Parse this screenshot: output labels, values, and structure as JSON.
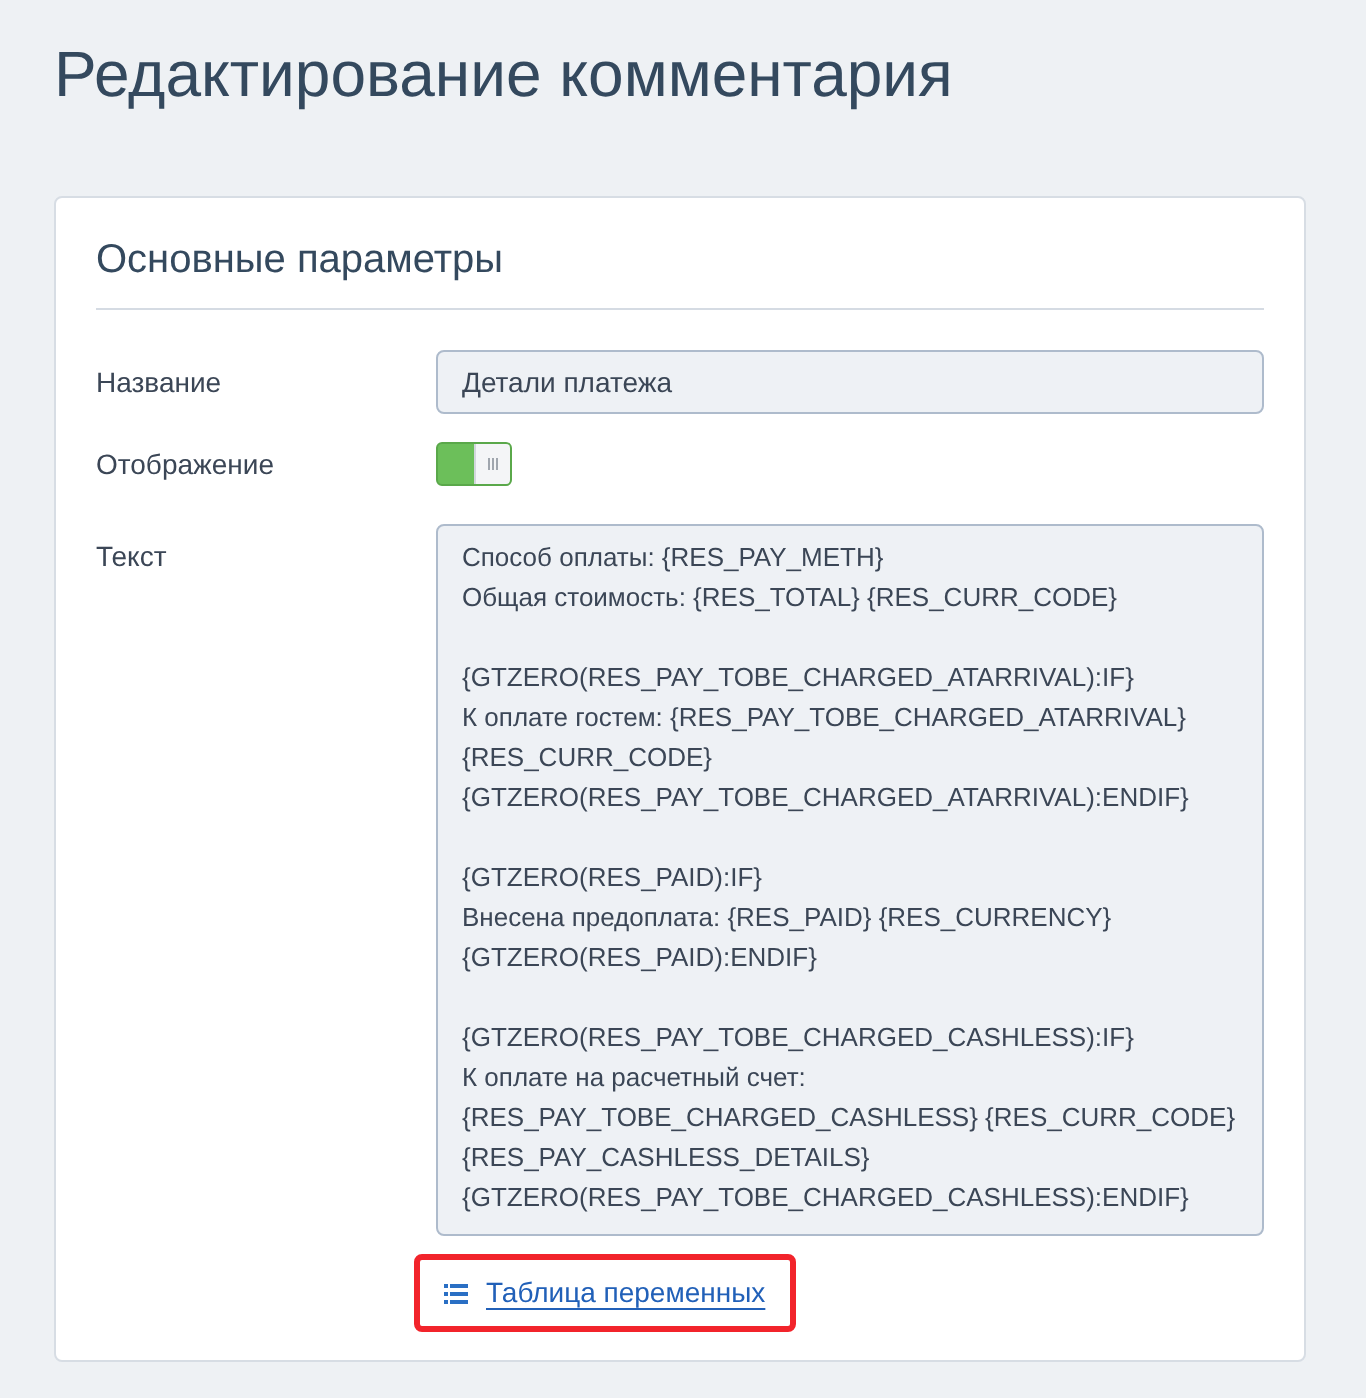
{
  "page": {
    "title": "Редактирование комментария"
  },
  "card": {
    "title": "Основные параметры",
    "fields": [
      {
        "kind": "input",
        "label": "Название",
        "value": "Детали платежа"
      },
      {
        "kind": "toggle",
        "label": "Отображение",
        "on": true
      },
      {
        "kind": "textarea",
        "label": "Текст",
        "value": "Способ оплаты: {RES_PAY_METH}\nОбщая стоимость: {RES_TOTAL} {RES_CURR_CODE}\n\n{GTZERO(RES_PAY_TOBE_CHARGED_ATARRIVAL):IF}\nК оплате гостем: {RES_PAY_TOBE_CHARGED_ATARRIVAL}\n{RES_CURR_CODE}\n{GTZERO(RES_PAY_TOBE_CHARGED_ATARRIVAL):ENDIF}\n\n{GTZERO(RES_PAID):IF}\nВнесена предоплата: {RES_PAID} {RES_CURRENCY}\n{GTZERO(RES_PAID):ENDIF}\n\n{GTZERO(RES_PAY_TOBE_CHARGED_CASHLESS):IF}\nК оплате на расчетный счет:\n{RES_PAY_TOBE_CHARGED_CASHLESS} {RES_CURR_CODE}\n{RES_PAY_CASHLESS_DETAILS}\n{GTZERO(RES_PAY_TOBE_CHARGED_CASHLESS):ENDIF}"
      }
    ],
    "link": {
      "label": "Таблица переменных",
      "highlighted": true
    }
  }
}
